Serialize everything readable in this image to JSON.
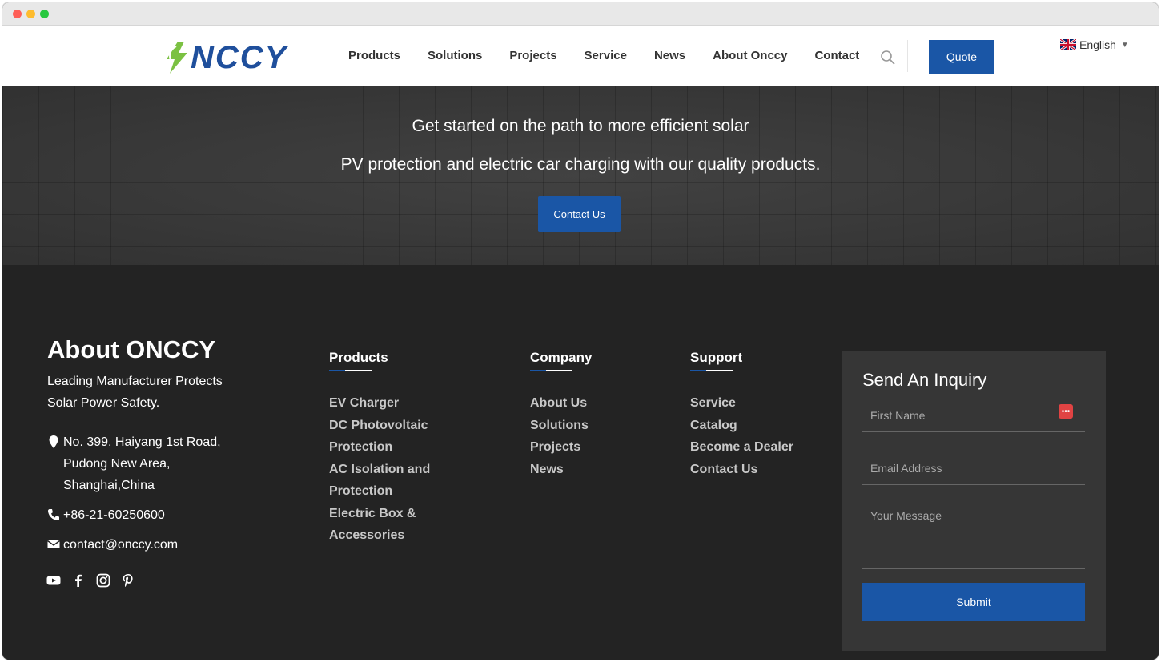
{
  "header": {
    "logo_text": "NCCY",
    "nav": [
      "Products",
      "Solutions",
      "Projects",
      "Service",
      "News",
      "About Onccy",
      "Contact"
    ],
    "quote_label": "Quote",
    "language": "English",
    "icons": {
      "search": "search-icon",
      "flag": "uk-flag-icon",
      "caret": "caret-down-icon"
    }
  },
  "hero": {
    "line1": "Get started on the path to more efficient solar",
    "line2": "PV protection and electric car charging with our quality products.",
    "button": "Contact Us"
  },
  "footer": {
    "about": {
      "title": "About ONCCY",
      "description": "Leading Manufacturer Protects Solar Power Safety.",
      "address": "No. 399, Haiyang 1st Road, Pudong New Area, Shanghai,China",
      "phone": "+86-21-60250600",
      "email": "contact@onccy.com",
      "social": [
        "youtube-icon",
        "facebook-icon",
        "instagram-icon",
        "pinterest-icon"
      ]
    },
    "columns": [
      {
        "title": "Products",
        "items": [
          "EV Charger",
          "DC Photovoltaic Protection",
          "AC Isolation and Protection",
          "Electric Box & Accessories"
        ]
      },
      {
        "title": "Company",
        "items": [
          "About Us",
          "Solutions",
          "Projects",
          "News"
        ]
      },
      {
        "title": "Support",
        "items": [
          "Service",
          "Catalog",
          "Become a Dealer",
          "Contact Us"
        ]
      }
    ],
    "inquiry": {
      "title": "Send An Inquiry",
      "first_name_placeholder": "First Name",
      "email_placeholder": "Email Address",
      "message_placeholder": "Your Message",
      "submit": "Submit"
    }
  },
  "colors": {
    "brand_blue": "#1a56a6",
    "footer_bg": "#232323",
    "logo_green": "#7bc142"
  }
}
